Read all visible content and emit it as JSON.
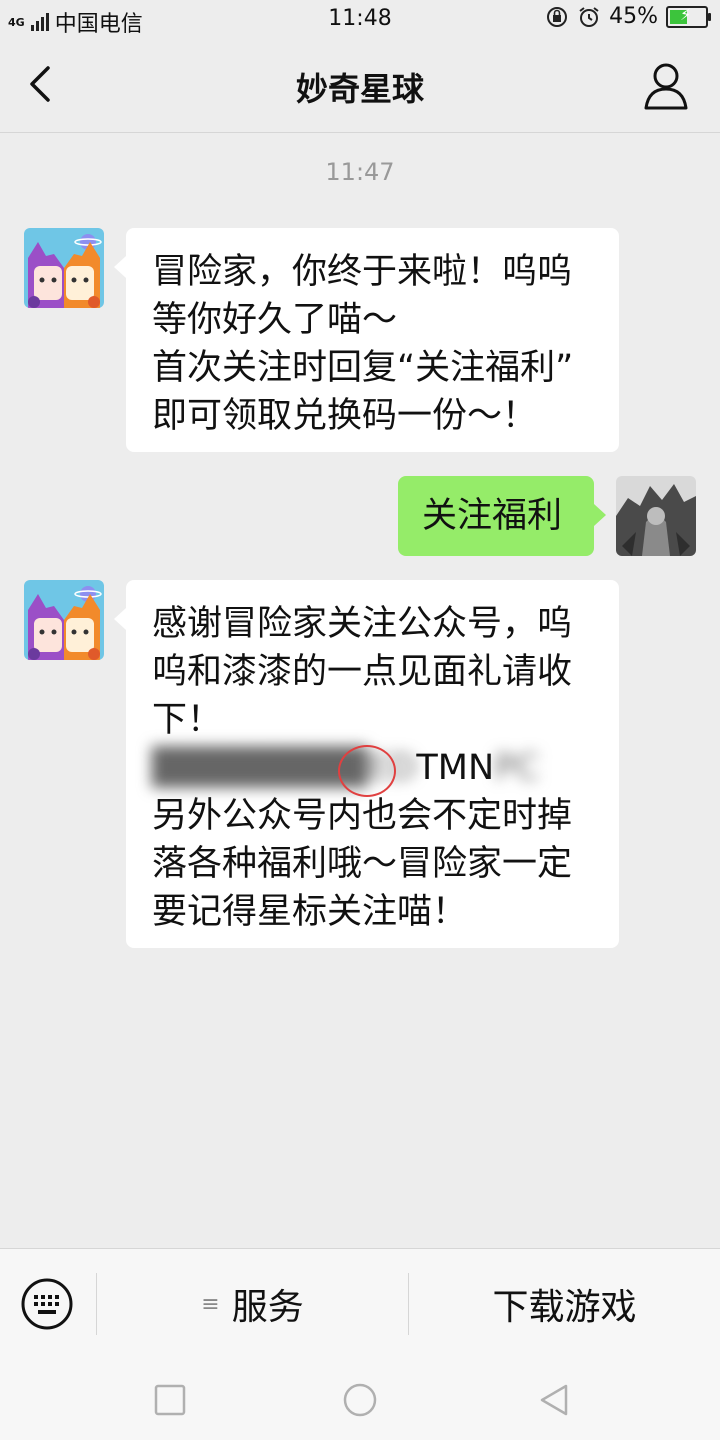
{
  "status_bar": {
    "network": "4G",
    "carrier": "中国电信",
    "time": "11:48",
    "battery": "45%"
  },
  "header": {
    "title": "妙奇星球",
    "back_icon": "chevron-left-icon",
    "profile_icon": "person-icon"
  },
  "chat": {
    "timestamp": "11:47",
    "messages": [
      {
        "sender": "official_account",
        "lines": [
          "冒险家，你终于来啦！呜呜",
          "等你好久了喵～",
          "首次关注时回复“关注福利”",
          "即可领取兑换码一份～！"
        ]
      },
      {
        "sender": "user",
        "lines": [
          "关注福利"
        ]
      },
      {
        "sender": "official_account",
        "lines": [
          "感谢冒险家关注公众号，呜",
          "呜和漆漆的一点见面礼请收",
          "下！"
        ],
        "code_visible": "TMN",
        "lines_after": [
          "另外公众号内也会不定时掉",
          "落各种福利哦～冒险家一定",
          "要记得星标关注喵！"
        ]
      }
    ]
  },
  "bottom_menu": {
    "keyboard_icon": "keyboard-icon",
    "service_label": "服务",
    "download_label": "下载游戏"
  },
  "system_nav": {
    "icons": [
      "recent-apps-icon",
      "home-icon",
      "back-icon"
    ]
  },
  "colors": {
    "background": "#ededed",
    "sent_bubble": "#95ec69",
    "received_bubble": "#ffffff"
  }
}
